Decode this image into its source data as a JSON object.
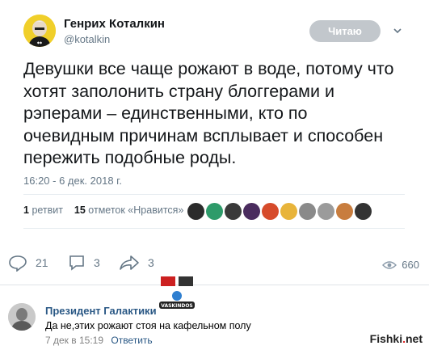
{
  "tweet": {
    "author_name": "Генрих Коталкин",
    "author_handle": "@kotalkin",
    "follow_label": "Читаю",
    "text": "Девушки все чаще рожают в воде, потому что хотят заполонить страну блоггерами и рэперами – единственными, кто по очевидным причинам всплывает и способен пережить подобные роды.",
    "timestamp": "16:20 - 6 дек. 2018 г.",
    "retweets_count": "1",
    "retweets_label": "ретвит",
    "likes_count": "15",
    "likes_label": "отметок «Нравится»",
    "liker_colors": [
      "#2b2b2b",
      "#2e9b6a",
      "#3a3a3a",
      "#4a2c5e",
      "#d64b2b",
      "#e8b43a",
      "#8a8a8a",
      "#9b9b9b",
      "#c87d3e",
      "#333333"
    ]
  },
  "actions": {
    "replies": "21",
    "retweets": "3",
    "shares": "3",
    "views": "660"
  },
  "comment": {
    "author": "Президент Галактики",
    "text": "Да не,этих рожают стоя на кафельном полу",
    "date": "7 дек в 15:19",
    "reply_label": "Ответить"
  },
  "watermark": {
    "text_a": "Fishki",
    "dot": ".",
    "text_b": "net"
  },
  "logo": {
    "text": "VASKINDOS"
  }
}
